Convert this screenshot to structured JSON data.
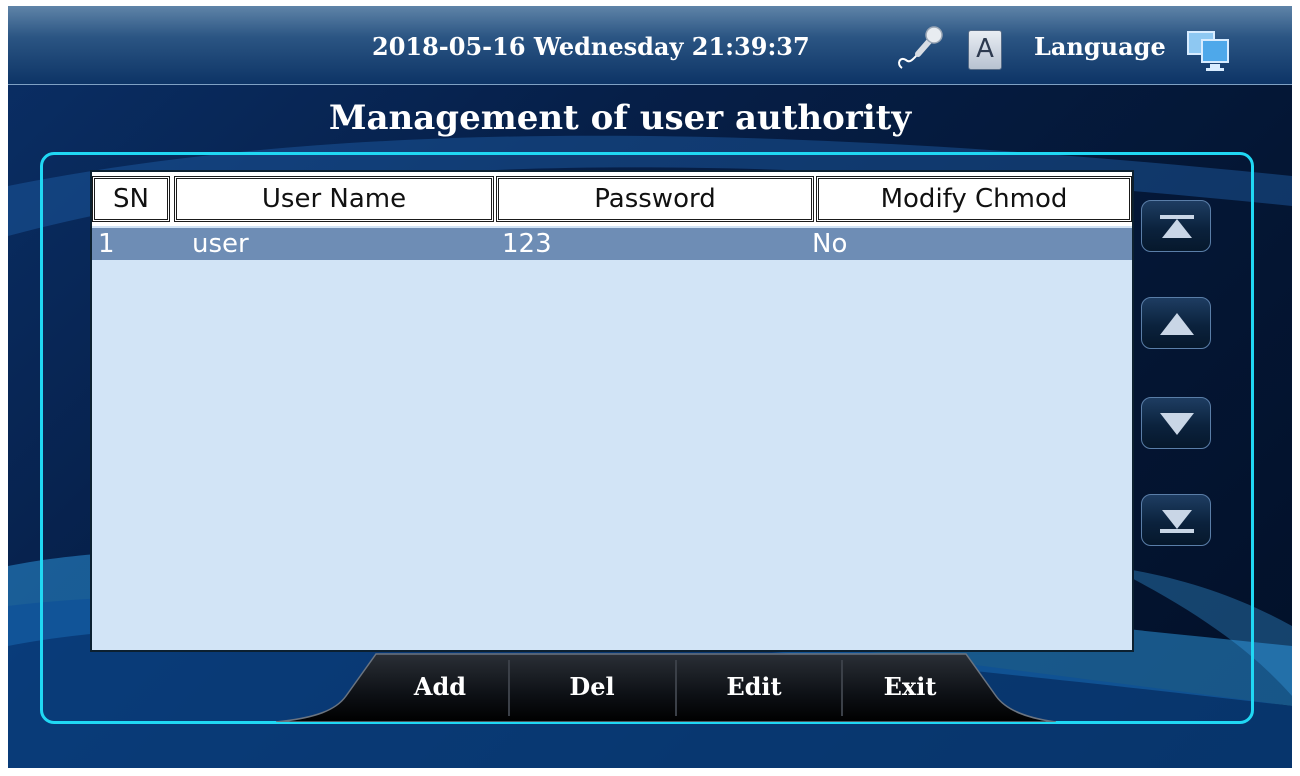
{
  "status_bar": {
    "datetime": "2018-05-16  Wednesday  21:39:37",
    "font_button": "A",
    "language_label": "Language",
    "icons": [
      "microphone-icon",
      "font-icon",
      "computer-icon"
    ]
  },
  "page": {
    "title": "Management of user authority"
  },
  "table": {
    "columns": [
      "SN",
      "User Name",
      "Password",
      "Modify Chmod"
    ],
    "rows": [
      {
        "sn": "1",
        "user_name": "user",
        "password": "123",
        "modify_chmod": "No",
        "selected": true
      }
    ]
  },
  "scroll_buttons": [
    "scroll-top-icon",
    "scroll-up-icon",
    "scroll-down-icon",
    "scroll-bottom-icon"
  ],
  "actions": {
    "add": "Add",
    "del": "Del",
    "edit": "Edit",
    "exit": "Exit"
  },
  "colors": {
    "frame_accent": "#20d8f4",
    "table_bg": "#d2e4f6",
    "selected_row": "#6e8db5",
    "background": "#041634"
  }
}
